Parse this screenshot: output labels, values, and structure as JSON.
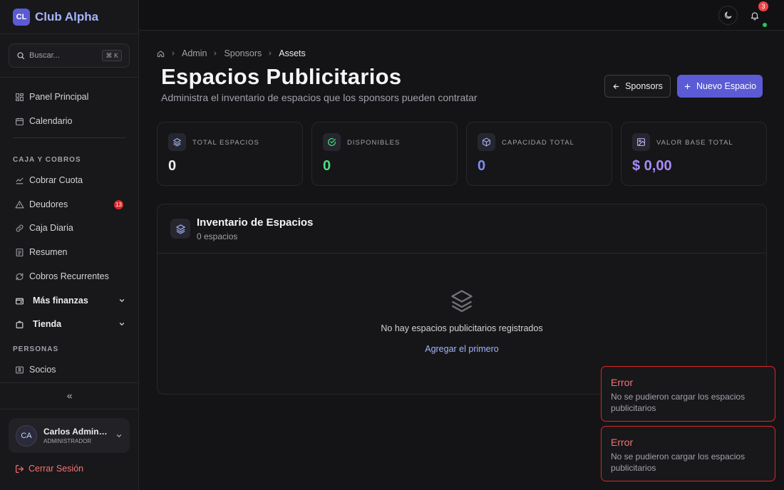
{
  "app": {
    "logo_text": "CL",
    "name": "Club Alpha"
  },
  "search": {
    "placeholder": "Buscar...",
    "shortcut": "⌘ K"
  },
  "sidebar": {
    "top_items": [
      {
        "label": "Panel Principal",
        "icon": "dashboard-icon"
      },
      {
        "label": "Calendario",
        "icon": "calendar-icon"
      }
    ],
    "section_caja": "CAJA Y COBROS",
    "caja_items": [
      {
        "label": "Cobrar Cuota",
        "icon": "pay-icon"
      },
      {
        "label": "Deudores",
        "icon": "alert-triangle-icon",
        "badge": "13"
      },
      {
        "label": "Caja Diaria",
        "icon": "link-icon"
      },
      {
        "label": "Resumen",
        "icon": "receipt-icon"
      },
      {
        "label": "Cobros Recurrentes",
        "icon": "refresh-icon"
      }
    ],
    "groups": [
      {
        "label": "Más finanzas",
        "icon": "wallet-icon"
      },
      {
        "label": "Tienda",
        "icon": "shopping-bag-icon"
      }
    ],
    "section_personas": "PERSONAS",
    "personas_items": [
      {
        "label": "Socios",
        "icon": "id-card-icon"
      }
    ],
    "user": {
      "initials": "CA",
      "name": "Carlos Administrador",
      "role": "ADMINISTRADOR"
    },
    "logout_label": "Cerrar Sesión"
  },
  "topbar": {
    "notification_count": "3"
  },
  "breadcrumb": {
    "items": [
      "Admin",
      "Sponsors"
    ],
    "current": "Assets"
  },
  "page": {
    "title": "Espacios Publicitarios",
    "subtitle": "Administra el inventario de espacios que los sponsors pueden contratar",
    "back_button": "Sponsors",
    "new_button": "Nuevo Espacio"
  },
  "stats": [
    {
      "label": "TOTAL ESPACIOS",
      "value": "0",
      "color": "#ededed",
      "icon": "layers-icon",
      "icon_color": "#a5b4fc"
    },
    {
      "label": "DISPONIBLES",
      "value": "0",
      "color": "#4ade80",
      "icon": "check-circle-icon",
      "icon_color": "#4ade80"
    },
    {
      "label": "CAPACIDAD TOTAL",
      "value": "0",
      "color": "#818cf8",
      "icon": "box-icon",
      "icon_color": "#a5b4fc"
    },
    {
      "label": "VALOR BASE TOTAL",
      "value": "$ 0,00",
      "color": "#a78bfa",
      "icon": "image-icon",
      "icon_color": "#c4b5fd"
    }
  ],
  "inventory": {
    "title": "Inventario de Espacios",
    "count": "0 espacios",
    "empty_text": "No hay espacios publicitarios registrados",
    "empty_link": "Agregar el primero"
  },
  "toasts": [
    {
      "title": "Error",
      "message": "No se pudieron cargar los espacios publicitarios"
    },
    {
      "title": "Error",
      "message": "No se pudieron cargar los espacios publicitarios"
    }
  ],
  "colors": {
    "accent": "#5b5bd6",
    "error": "#f87171",
    "success": "#22c55e"
  }
}
